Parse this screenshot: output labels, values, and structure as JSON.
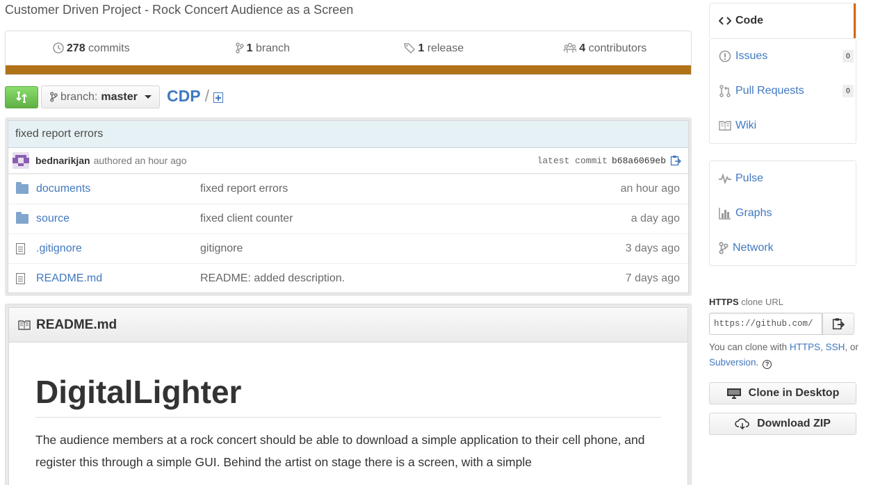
{
  "repo": {
    "description": "Customer Driven Project - Rock Concert Audience as a Screen",
    "name": "CDP",
    "separator": "/",
    "language_color": "#b07219"
  },
  "stats": {
    "commits": {
      "count": "278",
      "label": "commits"
    },
    "branches": {
      "count": "1",
      "label": "branch"
    },
    "releases": {
      "count": "1",
      "label": "release"
    },
    "contributors": {
      "count": "4",
      "label": "contributors"
    }
  },
  "branch": {
    "label": "branch:",
    "name": "master"
  },
  "latest_commit": {
    "message": "fixed report errors",
    "author": "bednarikjan",
    "authored": "authored an hour ago",
    "label": "latest commit",
    "sha": "b68a6069eb"
  },
  "files": [
    {
      "type": "dir",
      "name": "documents",
      "message": "fixed report errors",
      "age": "an hour ago"
    },
    {
      "type": "dir",
      "name": "source",
      "message": "fixed client counter",
      "age": "a day ago"
    },
    {
      "type": "file",
      "name": ".gitignore",
      "message": "gitignore",
      "age": "3 days ago"
    },
    {
      "type": "file",
      "name": "README.md",
      "message": "README: added description.",
      "age": "7 days ago"
    }
  ],
  "readme": {
    "filename": "README.md",
    "heading": "DigitalLighter",
    "paragraph": "The audience members at a rock concert should be able to download a simple application to their cell phone, and register this through a simple GUI. Behind the artist on stage there is a screen, with a simple"
  },
  "nav": {
    "code": "Code",
    "issues": {
      "label": "Issues",
      "count": "0"
    },
    "pulls": {
      "label": "Pull Requests",
      "count": "0"
    },
    "wiki": "Wiki",
    "pulse": "Pulse",
    "graphs": "Graphs",
    "network": "Network"
  },
  "clone": {
    "protocol": "HTTPS",
    "title_suffix": "clone URL",
    "url": "https://github.com/",
    "help_prefix": "You can clone with",
    "https": "HTTPS",
    "comma": ",",
    "ssh": "SSH",
    "or": ", or",
    "subversion": "Subversion",
    "period": ".",
    "help_icon": "?",
    "desktop_button": "Clone in Desktop",
    "zip_button": "Download ZIP"
  }
}
